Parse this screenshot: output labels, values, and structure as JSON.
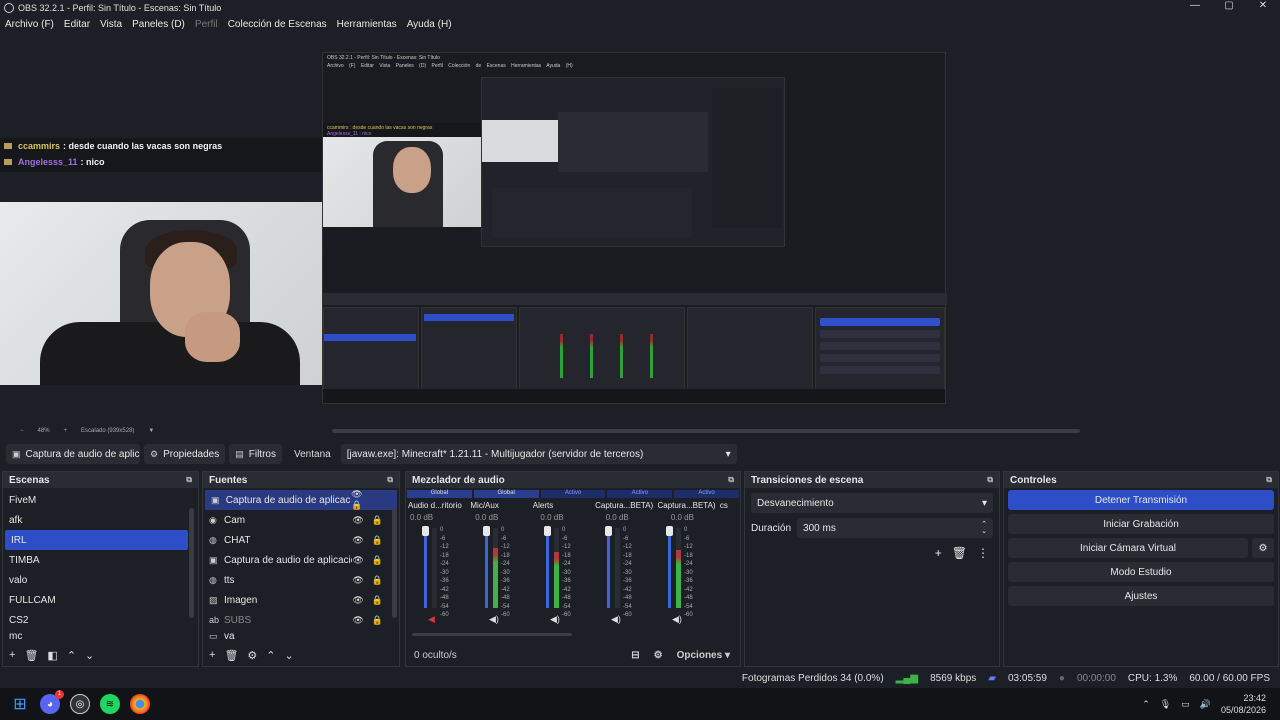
{
  "window": {
    "title": "OBS 32.2.1 - Perfil: Sin Título - Escenas: Sin Título",
    "controls": [
      "—",
      "▢",
      "✕"
    ]
  },
  "menu": [
    "Archivo (F)",
    "Editar",
    "Vista",
    "Paneles (D)",
    "Perfil",
    "Colección de Escenas",
    "Herramientas",
    "Ayuda (H)"
  ],
  "chat": [
    {
      "user": "ccammirs",
      "message": ": desde cuando las vacas son negras"
    },
    {
      "user": "Angelesss_11",
      "message": ": nico"
    }
  ],
  "inner": {
    "title": "OBS 32.2.1 - Perfil: Sin Título - Escenas: Sin Título",
    "menu": "Archivo (F) Editar Vista Paneles (D) Perfil Colección de Escenas Herramientas Ayuda (H)",
    "chat1": "ccammirs : desde cuando las vacas son negras",
    "chat2": "Angelesss_11 : nico"
  },
  "preview_status": {
    "zoom": "48%",
    "scale": "Escalado (939x528)"
  },
  "toolbar": {
    "source_name": "Captura de audio de aplicac",
    "properties": "Propiedades",
    "filters": "Filtros",
    "window_label": "Ventana",
    "window_value": "[javaw.exe]: Minecraft* 1.21.11 - Multijugador (servidor de terceros)"
  },
  "scenes": {
    "title": "Escenas",
    "items": [
      "FiveM",
      "afk",
      "IRL",
      "TIMBA",
      "valo",
      "FULLCAM",
      "CS2",
      "mc"
    ],
    "selected": "IRL"
  },
  "sources": {
    "title": "Fuentes",
    "items": [
      {
        "label": "Captura de audio de aplicación (E",
        "icon": "app-audio-icon"
      },
      {
        "label": "Cam",
        "icon": "camera-icon"
      },
      {
        "label": "CHAT",
        "icon": "globe-icon"
      },
      {
        "label": "Captura de audio de aplicación (E",
        "icon": "app-audio-icon"
      },
      {
        "label": "tts",
        "icon": "globe-icon"
      },
      {
        "label": "Imagen",
        "icon": "image-icon"
      },
      {
        "label": "SUBS",
        "icon": "text-icon"
      },
      {
        "label": "va",
        "icon": "window-icon"
      }
    ]
  },
  "mixer": {
    "title": "Mezclador de audio",
    "headers": [
      "Global",
      "Global",
      "Activo",
      "Activo",
      "Activo"
    ],
    "channels": [
      "Audio d...ritorio",
      "Mic/Aux",
      "Alerts",
      "Captura...BETA) 2",
      "Captura...BETA) 3",
      "cs"
    ],
    "db": "0.0 dB",
    "scale": [
      "0",
      "-6",
      "-12",
      "-18",
      "-24",
      "-30",
      "-36",
      "-42",
      "-48",
      "-54",
      "-60"
    ],
    "levels": [
      0.0,
      0.75,
      0.7,
      0.0,
      0.72
    ],
    "hidden": "0 oculto/s",
    "options": "Opciones"
  },
  "transitions": {
    "title": "Transiciones de escena",
    "selected": "Desvanecimiento",
    "duration_label": "Duración",
    "duration_value": "300 ms"
  },
  "controls": {
    "title": "Controles",
    "stop_stream": "Detener Transmisión",
    "start_record": "Iniciar Grabación",
    "start_virtual": "Iniciar Cámara Virtual",
    "studio": "Modo Estudio",
    "settings": "Ajustes"
  },
  "status": {
    "dropped": "Fotogramas Perdidos 34 (0.0%)",
    "bitrate": "8569 kbps",
    "stream_time": "03:05:59",
    "rec_time": "00:00:00",
    "cpu": "CPU: 1.3%",
    "fps": "60.00 / 60.00 FPS"
  },
  "taskbar": {
    "time": "23:42",
    "date": "05/08/2026",
    "badge": "1"
  },
  "colors": {
    "accent": "#2e4ec8",
    "bg": "#1d1f26",
    "panel": "#2a2c34",
    "meter_green": "#3db24a",
    "meter_red": "#b03a3a"
  }
}
